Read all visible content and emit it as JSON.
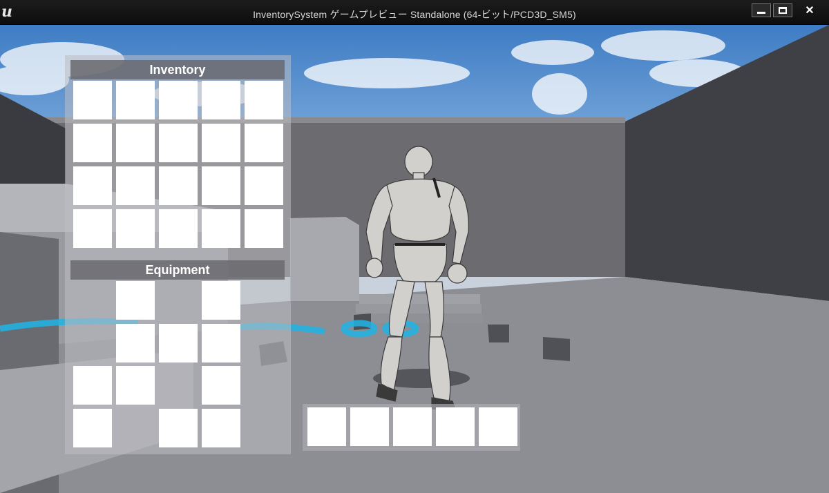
{
  "window": {
    "title": "InventorySystem ゲームプレビュー Standalone (64-ビット/PCD3D_SM5)",
    "logo": "unreal-engine-logo",
    "buttons": {
      "minimize": "minimize-icon",
      "maximize": "maximize-icon",
      "close": "✕"
    }
  },
  "inventory": {
    "title": "Inventory",
    "rows": 4,
    "columns": 5,
    "slot_count": 20
  },
  "equipment": {
    "title": "Equipment",
    "slot_count": 11
  },
  "hotbar": {
    "slot_count": 5
  },
  "colors": {
    "slot": "#ffffff",
    "panel": "#bebec3",
    "header": "#69696e",
    "accent_floor_text": "#1eb4e6"
  }
}
